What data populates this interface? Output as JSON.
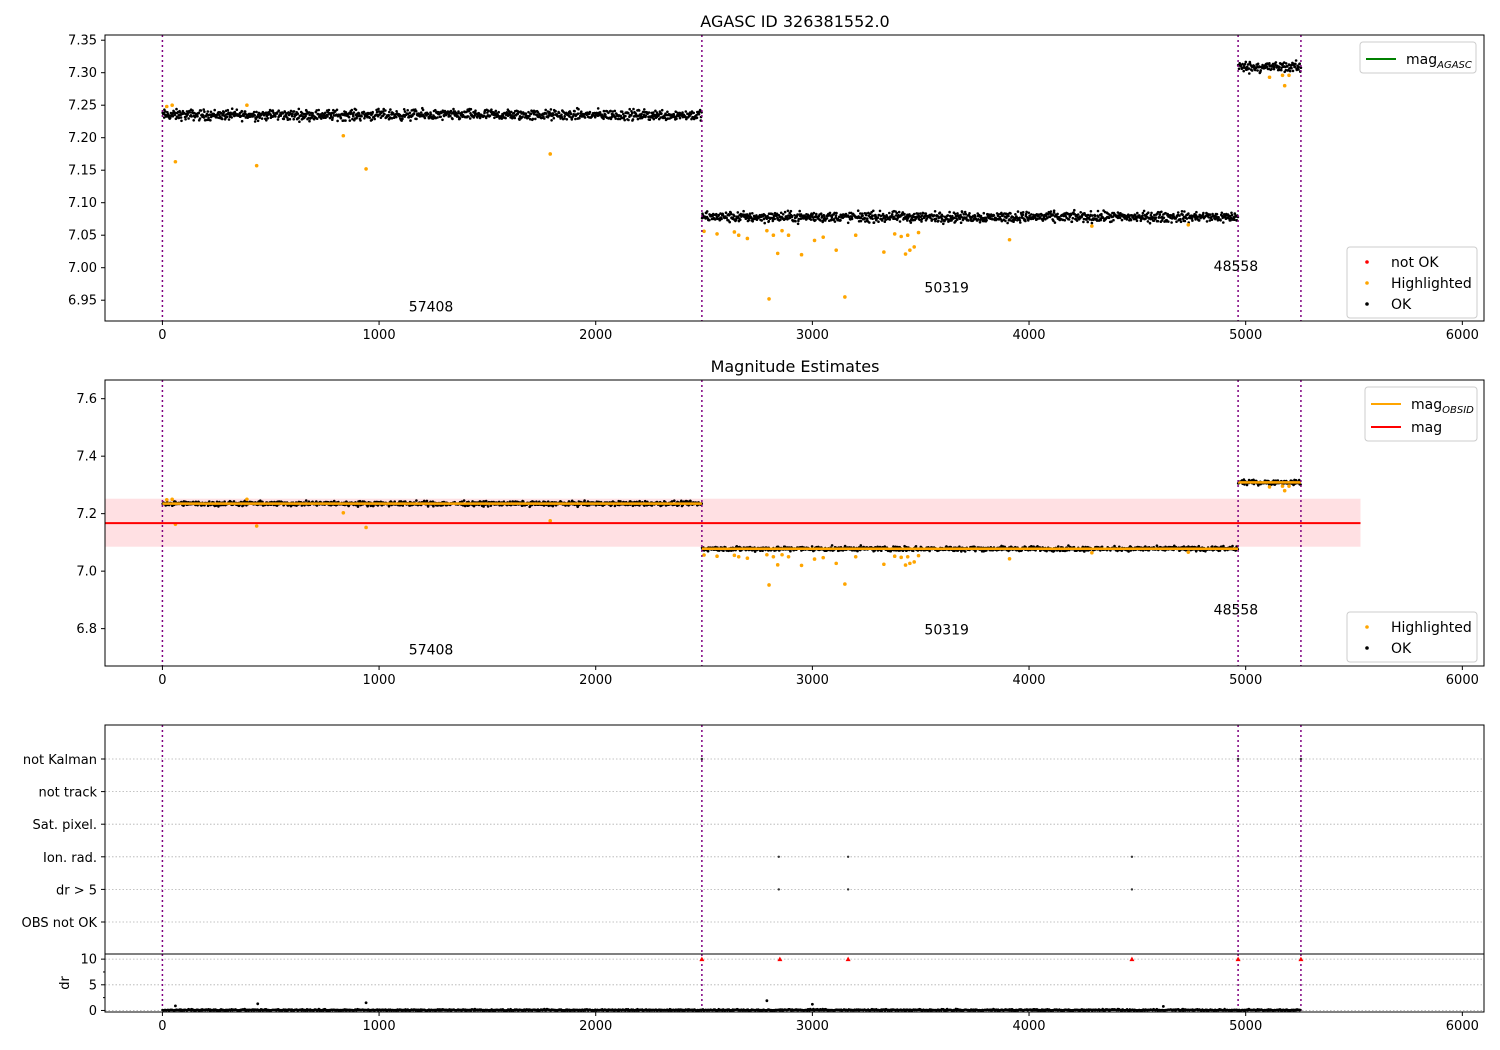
{
  "colors": {
    "ok": "#000000",
    "highlighted": "#ffa500",
    "not_ok": "#ff0000",
    "mag_line": "#ff0000",
    "mag_band": "#ffe0e3",
    "agasc_line": "#008000",
    "obs_boundary": "#800080",
    "grid": "#b0b0b0"
  },
  "obs_boundaries": [
    0,
    2490,
    4965,
    5255
  ],
  "chart_data": [
    {
      "id": "top",
      "type": "scatter",
      "title": "AGASC ID 326381552.0",
      "xlim": [
        -265,
        6100
      ],
      "ylim": [
        6.918,
        7.358
      ],
      "xticks": [
        0,
        1000,
        2000,
        3000,
        4000,
        5000,
        6000
      ],
      "yticks": [
        6.95,
        7.0,
        7.05,
        7.1,
        7.15,
        7.2,
        7.25,
        7.3,
        7.35
      ],
      "ytick_labels": [
        "6.95",
        "7.00",
        "7.05",
        "7.10",
        "7.15",
        "7.20",
        "7.25",
        "7.30",
        "7.35"
      ],
      "grid": false,
      "segments": [
        {
          "x": [
            0,
            2490
          ],
          "mag": 7.235,
          "spread": 0.012
        },
        {
          "x": [
            2490,
            4965
          ],
          "mag": 7.078,
          "spread": 0.012
        },
        {
          "x": [
            4965,
            5255
          ],
          "mag": 7.309,
          "spread": 0.012
        }
      ],
      "highlighted": [
        [
          20,
          7.248
        ],
        [
          45,
          7.25
        ],
        [
          60,
          7.163
        ],
        [
          390,
          7.25
        ],
        [
          435,
          7.157
        ],
        [
          835,
          7.203
        ],
        [
          940,
          7.152
        ],
        [
          1790,
          7.175
        ],
        [
          2500,
          7.056
        ],
        [
          2560,
          7.052
        ],
        [
          2640,
          7.055
        ],
        [
          2660,
          7.05
        ],
        [
          2700,
          7.045
        ],
        [
          2790,
          7.057
        ],
        [
          2800,
          6.952
        ],
        [
          2820,
          7.05
        ],
        [
          2840,
          7.022
        ],
        [
          2860,
          7.057
        ],
        [
          2890,
          7.05
        ],
        [
          2950,
          7.02
        ],
        [
          3010,
          7.042
        ],
        [
          3050,
          7.047
        ],
        [
          3110,
          7.027
        ],
        [
          3150,
          6.955
        ],
        [
          3200,
          7.05
        ],
        [
          3330,
          7.024
        ],
        [
          3380,
          7.052
        ],
        [
          3410,
          7.048
        ],
        [
          3430,
          7.021
        ],
        [
          3440,
          7.05
        ],
        [
          3450,
          7.027
        ],
        [
          3470,
          7.032
        ],
        [
          3490,
          7.054
        ],
        [
          3910,
          7.043
        ],
        [
          4290,
          7.064
        ],
        [
          4735,
          7.066
        ],
        [
          5110,
          7.293
        ],
        [
          5170,
          7.296
        ],
        [
          5180,
          7.28
        ],
        [
          5200,
          7.296
        ]
      ],
      "obs_labels": [
        {
          "text": "57408",
          "x": 1240,
          "y": 6.933
        },
        {
          "text": "50319",
          "x": 3620,
          "y": 6.962
        },
        {
          "text": "48558",
          "x": 4955,
          "y": 6.995
        }
      ],
      "legend_upper": {
        "placement": "upper right",
        "entries": [
          {
            "label_main": "mag",
            "label_sub": "AGASC",
            "kind": "line",
            "color": "#008000"
          }
        ]
      },
      "legend_lower": {
        "placement": "lower right",
        "entries": [
          {
            "label": "not OK",
            "kind": "dot",
            "color": "#ff0000"
          },
          {
            "label": "Highlighted",
            "kind": "dot",
            "color": "#ffa500"
          },
          {
            "label": "OK",
            "kind": "dot",
            "color": "#000000"
          }
        ]
      }
    },
    {
      "id": "middle",
      "type": "scatter",
      "title": "Magnitude Estimates",
      "xlim": [
        -265,
        6100
      ],
      "ylim": [
        6.67,
        7.665
      ],
      "xticks": [
        0,
        1000,
        2000,
        3000,
        4000,
        5000,
        6000
      ],
      "yticks": [
        6.8,
        7.0,
        7.2,
        7.4,
        7.6
      ],
      "ytick_labels": [
        "6.8",
        "7.0",
        "7.2",
        "7.4",
        "7.6"
      ],
      "grid": false,
      "mag": 7.167,
      "mag_band": [
        7.085,
        7.252
      ],
      "mag_band_x": [
        -265,
        5530
      ],
      "segments": [
        {
          "x": [
            0,
            2490
          ],
          "mag": 7.235,
          "spread": 0.012
        },
        {
          "x": [
            2490,
            4965
          ],
          "mag": 7.078,
          "spread": 0.012
        },
        {
          "x": [
            4965,
            5255
          ],
          "mag": 7.309,
          "spread": 0.012
        }
      ],
      "highlighted": [
        [
          20,
          7.248
        ],
        [
          45,
          7.25
        ],
        [
          60,
          7.163
        ],
        [
          390,
          7.25
        ],
        [
          435,
          7.157
        ],
        [
          835,
          7.203
        ],
        [
          940,
          7.152
        ],
        [
          1790,
          7.175
        ],
        [
          2500,
          7.056
        ],
        [
          2560,
          7.052
        ],
        [
          2640,
          7.055
        ],
        [
          2660,
          7.05
        ],
        [
          2700,
          7.045
        ],
        [
          2790,
          7.057
        ],
        [
          2800,
          6.952
        ],
        [
          2820,
          7.05
        ],
        [
          2840,
          7.022
        ],
        [
          2860,
          7.057
        ],
        [
          2890,
          7.05
        ],
        [
          2950,
          7.02
        ],
        [
          3010,
          7.042
        ],
        [
          3050,
          7.047
        ],
        [
          3110,
          7.027
        ],
        [
          3150,
          6.955
        ],
        [
          3200,
          7.05
        ],
        [
          3330,
          7.024
        ],
        [
          3380,
          7.052
        ],
        [
          3410,
          7.048
        ],
        [
          3430,
          7.021
        ],
        [
          3440,
          7.05
        ],
        [
          3450,
          7.027
        ],
        [
          3470,
          7.032
        ],
        [
          3490,
          7.054
        ],
        [
          3910,
          7.043
        ],
        [
          4290,
          7.064
        ],
        [
          4735,
          7.066
        ],
        [
          5110,
          7.293
        ],
        [
          5170,
          7.296
        ],
        [
          5180,
          7.28
        ],
        [
          5200,
          7.296
        ]
      ],
      "obs_labels": [
        {
          "text": "57408",
          "x": 1240,
          "y": 6.71
        },
        {
          "text": "50319",
          "x": 3620,
          "y": 6.78
        },
        {
          "text": "48558",
          "x": 4955,
          "y": 6.85
        }
      ],
      "legend_upper": {
        "placement": "upper right",
        "entries": [
          {
            "label_main": "mag",
            "label_sub": "OBSID",
            "kind": "line",
            "color": "#ffa500"
          },
          {
            "label_main": "mag",
            "label_sub": "",
            "kind": "line",
            "color": "#ff0000"
          }
        ]
      },
      "legend_lower": {
        "placement": "lower right",
        "entries": [
          {
            "label": "Highlighted",
            "kind": "dot",
            "color": "#ffa500"
          },
          {
            "label": "OK",
            "kind": "dot",
            "color": "#000000"
          }
        ]
      }
    },
    {
      "id": "flags",
      "type": "scatter",
      "xlim": [
        -265,
        6100
      ],
      "categories": [
        "not Kalman",
        "not track",
        "Sat. pixel.",
        "Ion. rad.",
        "dr > 5",
        "OBS not OK"
      ],
      "grid": true,
      "points": {
        "not Kalman": [
          2490,
          4965,
          5255
        ],
        "Ion. rad.": [
          2845,
          3165,
          4475
        ],
        "dr > 5": [
          2845,
          3165,
          4475
        ]
      }
    },
    {
      "id": "dr",
      "type": "scatter",
      "ylabel": "dr",
      "xlim": [
        -265,
        6100
      ],
      "ylim": [
        -0.3,
        11
      ],
      "xticks": [
        0,
        1000,
        2000,
        3000,
        4000,
        5000,
        6000
      ],
      "yticks": [
        0,
        5,
        10
      ],
      "ytick_labels": [
        "0",
        "5",
        "10"
      ],
      "grid": true,
      "baseline_spread": 0.35,
      "spikes": [
        [
          60,
          0.9
        ],
        [
          440,
          1.3
        ],
        [
          940,
          1.5
        ],
        [
          2790,
          1.9
        ],
        [
          3000,
          1.2
        ],
        [
          4620,
          0.8
        ]
      ],
      "not_ok_markers": [
        2490,
        2850,
        3165,
        4475,
        4965,
        5255
      ]
    }
  ]
}
